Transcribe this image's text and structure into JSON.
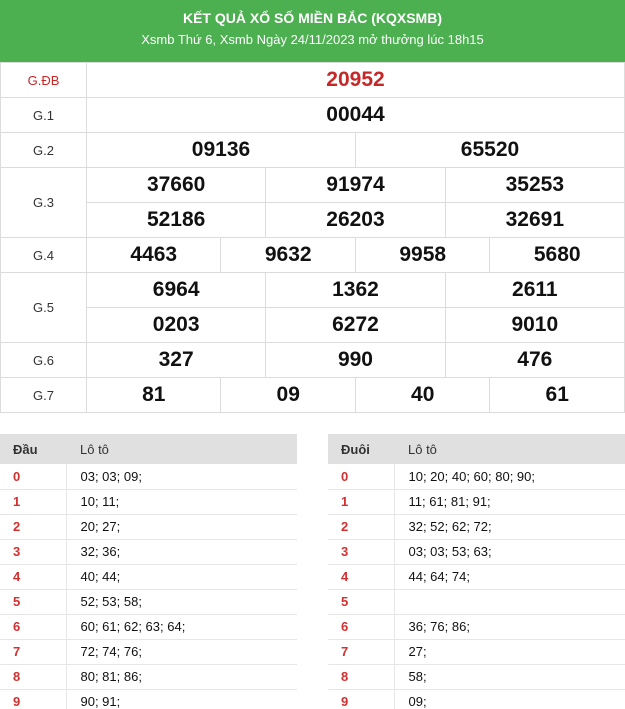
{
  "header": {
    "title": "KẾT QUẢ XỔ SỐ MIỀN BẮC (KQXSMB)",
    "subtitle": "Xsmb Thứ 6, Xsmb Ngày 24/11/2023 mở thưởng lúc 18h15"
  },
  "prizes": {
    "gdb": {
      "label": "G.ĐB",
      "numbers": [
        "20952"
      ]
    },
    "g1": {
      "label": "G.1",
      "numbers": [
        "00044"
      ]
    },
    "g2": {
      "label": "G.2",
      "numbers": [
        "09136",
        "65520"
      ]
    },
    "g3": {
      "label": "G.3",
      "numbers": [
        "37660",
        "91974",
        "35253",
        "52186",
        "26203",
        "32691"
      ]
    },
    "g4": {
      "label": "G.4",
      "numbers": [
        "4463",
        "9632",
        "9958",
        "5680"
      ]
    },
    "g5": {
      "label": "G.5",
      "numbers": [
        "6964",
        "1362",
        "2611",
        "0203",
        "6272",
        "9010"
      ]
    },
    "g6": {
      "label": "G.6",
      "numbers": [
        "327",
        "990",
        "476"
      ]
    },
    "g7": {
      "label": "G.7",
      "numbers": [
        "81",
        "09",
        "40",
        "61"
      ]
    }
  },
  "dau": {
    "col1": "Đầu",
    "col2": "Lô tô",
    "rows": [
      {
        "k": "0",
        "v": "03; 03; 09;"
      },
      {
        "k": "1",
        "v": "10; 11;"
      },
      {
        "k": "2",
        "v": "20; 27;"
      },
      {
        "k": "3",
        "v": "32; 36;"
      },
      {
        "k": "4",
        "v": "40; 44;"
      },
      {
        "k": "5",
        "v": "52; 53; 58;"
      },
      {
        "k": "6",
        "v": "60; 61; 62; 63; 64;"
      },
      {
        "k": "7",
        "v": "72; 74; 76;"
      },
      {
        "k": "8",
        "v": "80; 81; 86;"
      },
      {
        "k": "9",
        "v": "90; 91;"
      }
    ]
  },
  "duoi": {
    "col1": "Đuôi",
    "col2": "Lô tô",
    "rows": [
      {
        "k": "0",
        "v": "10; 20; 40; 60; 80; 90;"
      },
      {
        "k": "1",
        "v": "11; 61; 81; 91;"
      },
      {
        "k": "2",
        "v": "32; 52; 62; 72;"
      },
      {
        "k": "3",
        "v": "03; 03; 53; 63;"
      },
      {
        "k": "4",
        "v": "44; 64; 74;"
      },
      {
        "k": "5",
        "v": ""
      },
      {
        "k": "6",
        "v": "36; 76; 86;"
      },
      {
        "k": "7",
        "v": "27;"
      },
      {
        "k": "8",
        "v": "58;"
      },
      {
        "k": "9",
        "v": "09;"
      }
    ]
  },
  "colors": {
    "header_bg": "#4caf50",
    "special": "#c62828",
    "key": "#d32f2f"
  }
}
